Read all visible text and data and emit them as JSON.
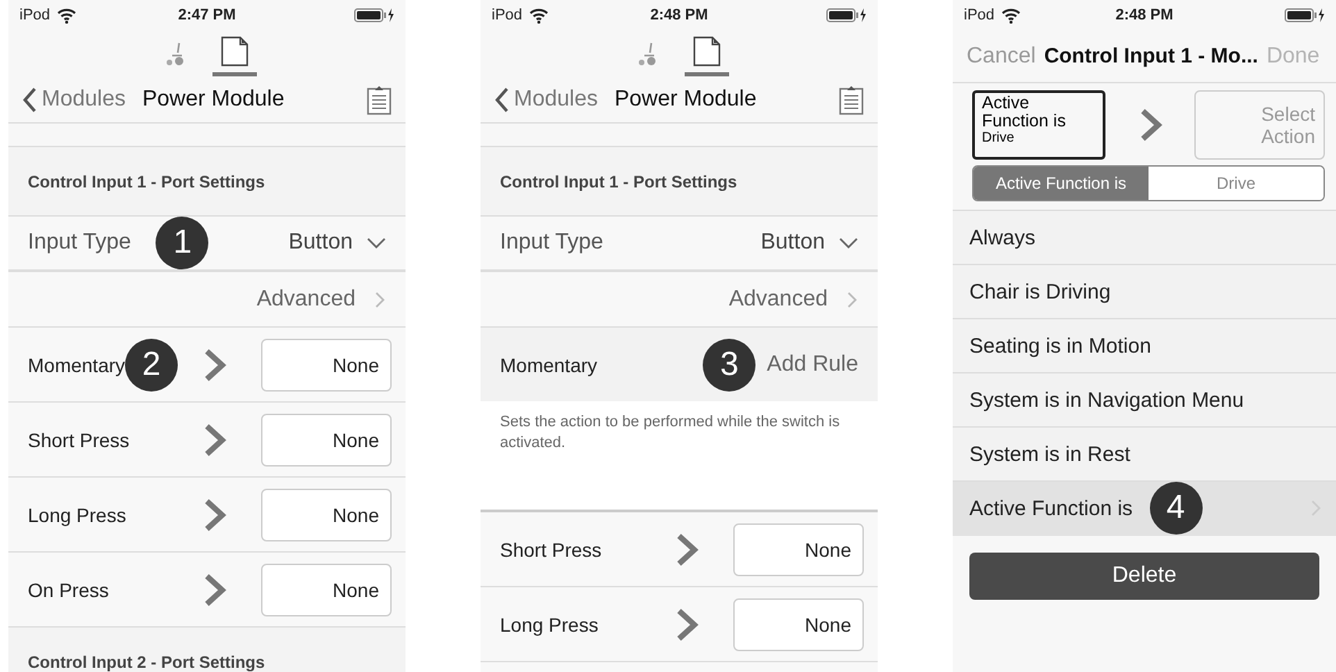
{
  "screens": [
    {
      "kind": "module",
      "status": {
        "carrier": "iPod",
        "time": "2:47 PM"
      },
      "tabs": [
        {
          "kind": "chair",
          "selected": false
        },
        {
          "kind": "document",
          "selected": true
        }
      ],
      "nav": {
        "back": "Modules",
        "title": "Power Module"
      },
      "rows": [
        {
          "kind": "header",
          "label": "Control Input 1 - Port Settings"
        },
        {
          "kind": "select",
          "label": "Input Type",
          "value": "Button",
          "badge": "1"
        },
        {
          "kind": "link",
          "label": "Advanced"
        },
        {
          "kind": "action",
          "label": "Momentary",
          "value": "None",
          "badge": "2"
        },
        {
          "kind": "action",
          "label": "Short Press",
          "value": "None"
        },
        {
          "kind": "action",
          "label": "Long Press",
          "value": "None"
        },
        {
          "kind": "action",
          "label": "On Press",
          "value": "None"
        },
        {
          "kind": "header",
          "label": "Control Input 2 - Port Settings"
        }
      ]
    },
    {
      "kind": "module",
      "status": {
        "carrier": "iPod",
        "time": "2:48 PM"
      },
      "tabs": [
        {
          "kind": "chair",
          "selected": false
        },
        {
          "kind": "document",
          "selected": true
        }
      ],
      "nav": {
        "back": "Modules",
        "title": "Power Module"
      },
      "rows": [
        {
          "kind": "header",
          "label": "Control Input 1 - Port Settings"
        },
        {
          "kind": "select",
          "label": "Input Type",
          "value": "Button"
        },
        {
          "kind": "link",
          "label": "Advanced"
        },
        {
          "kind": "rule",
          "label": "Momentary",
          "action": "Add Rule",
          "badge": "3"
        },
        {
          "kind": "note",
          "text": "Sets the action to be performed while the switch is activated."
        },
        {
          "kind": "action",
          "label": "Short Press",
          "value": "None"
        },
        {
          "kind": "action",
          "label": "Long Press",
          "value": "None"
        },
        {
          "kind": "action"
        }
      ]
    },
    {
      "kind": "picker",
      "status": {
        "carrier": "iPod",
        "time": "2:48 PM"
      },
      "nav": {
        "cancel": "Cancel",
        "title": "Control Input 1 - Mo...",
        "done": "Done",
        "done_disabled": true
      },
      "rule": {
        "condition": "Active Function is",
        "condition_value": "Drive",
        "action": "Select Action"
      },
      "segments": [
        {
          "label": "Active Function is",
          "selected": true
        },
        {
          "label": "Drive",
          "selected": false
        }
      ],
      "items": [
        {
          "label": "Always",
          "selected": false
        },
        {
          "label": "Chair is Driving",
          "selected": false
        },
        {
          "label": "Seating is in Motion",
          "selected": false
        },
        {
          "label": "System is in Navigation Menu",
          "selected": false
        },
        {
          "label": "System is in Rest",
          "selected": false
        },
        {
          "label": "Active Function is",
          "selected": true,
          "badge": "4"
        }
      ],
      "delete": "Delete"
    }
  ]
}
